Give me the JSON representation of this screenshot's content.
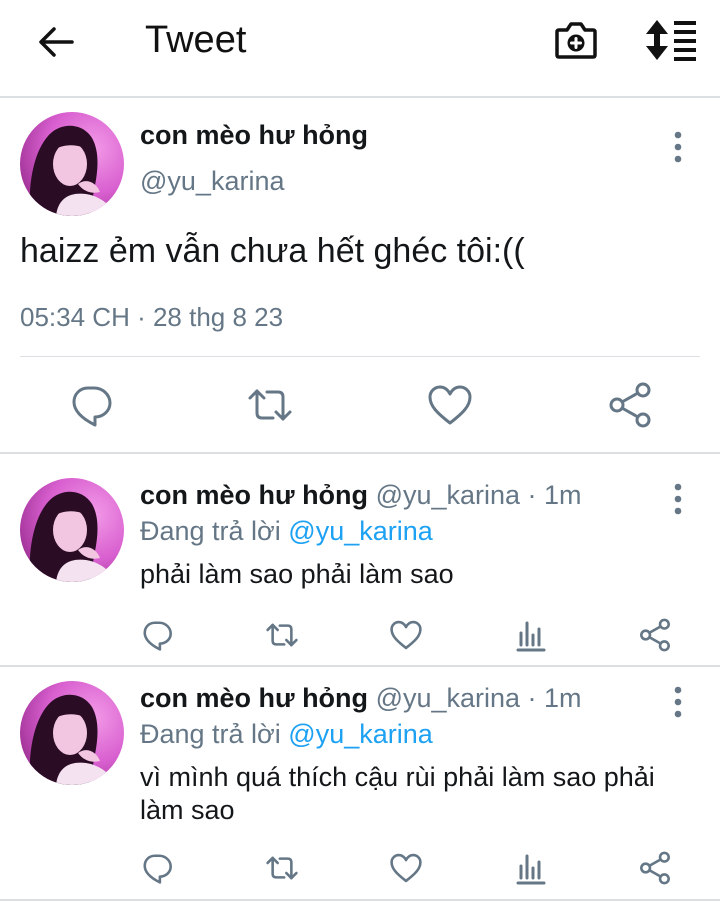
{
  "header": {
    "title": "Tweet",
    "icons": [
      "back-arrow-icon",
      "camera-plus-icon",
      "sort-list-icon"
    ]
  },
  "main_tweet": {
    "display_name": "con mèo hư hỏng",
    "handle": "@yu_karina",
    "text": "haizz ẻm vẫn chưa hết ghéc tôi:((",
    "timestamp": "05:34 CH · 28 thg 8 23",
    "actions": [
      "reply-icon",
      "retweet-icon",
      "like-icon",
      "share-icon"
    ]
  },
  "replies": [
    {
      "display_name": "con mèo hư hỏng",
      "handle_time": "@yu_karina · 1m",
      "replying_prefix": "Đang trả lời",
      "replying_to": "@yu_karina",
      "text": "phải làm sao phải làm sao"
    },
    {
      "display_name": "con mèo hư hỏng",
      "handle_time": "@yu_karina · 1m",
      "replying_prefix": "Đang trả lời",
      "replying_to": "@yu_karina",
      "text": "vì mình quá thích cậu rùi phải làm sao phải làm sao"
    }
  ],
  "colors": {
    "accent": "#1da1f2",
    "muted": "#657786",
    "icon": "#657786",
    "divider": "#dcdfe2",
    "avatar_pink": "#e26fd6",
    "avatar_dark": "#3a1030"
  }
}
